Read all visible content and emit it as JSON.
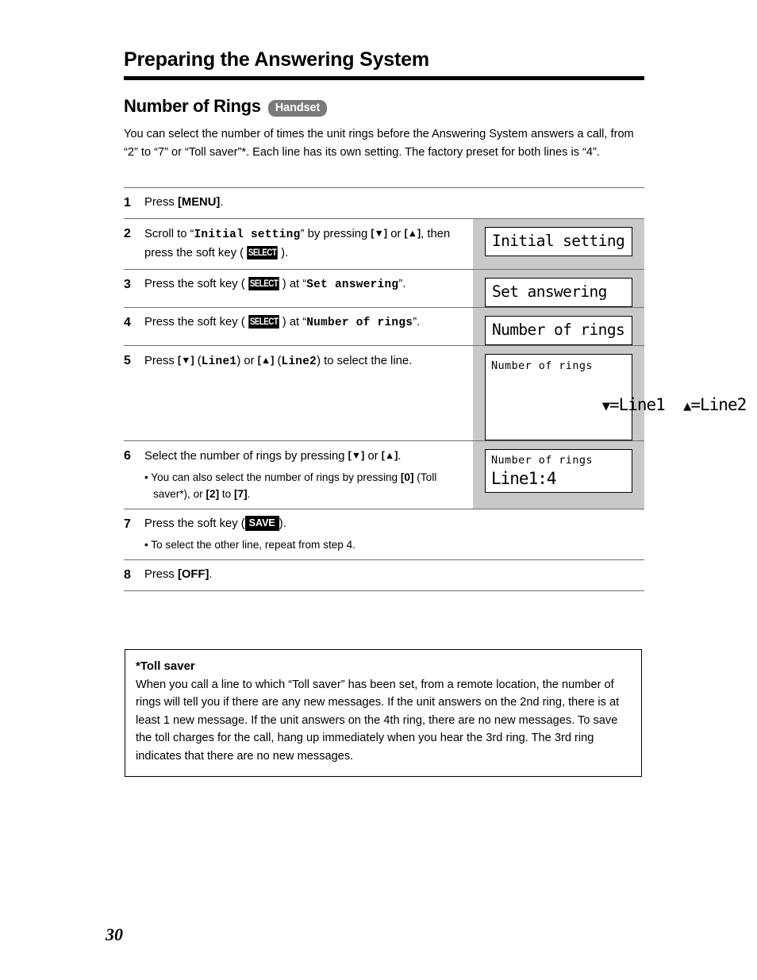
{
  "header": {
    "chapter_title": "Preparing the Answering System"
  },
  "section": {
    "title": "Number of Rings",
    "badge": "Handset",
    "intro": "You can select the number of times the unit rings before the Answering System answers a call, from “2” to “7” or “Toll saver”*. Each line has its own setting. The factory preset for both lines is “4”."
  },
  "steps": [
    {
      "num": "1",
      "text_parts": {
        "a": "Press ",
        "key": "[MENU]",
        "b": "."
      }
    },
    {
      "num": "2",
      "text_parts": {
        "a": "Scroll to “",
        "mono1": "Initial setting",
        "b": "” by pressing ",
        "key1": "[▼]",
        "c": " or ",
        "key2": "[▲]",
        "d": ", then press the soft key (",
        "softkey": "SELECT",
        "e": ")."
      },
      "lcd": {
        "lines": [
          "Initial setting"
        ]
      }
    },
    {
      "num": "3",
      "text_parts": {
        "a": "Press the soft key (",
        "softkey": "SELECT",
        "b": ") at “",
        "mono1": "Set answering",
        "c": "”."
      },
      "lcd": {
        "lines": [
          "Set answering"
        ]
      }
    },
    {
      "num": "4",
      "text_parts": {
        "a": "Press the soft key (",
        "softkey": "SELECT",
        "b": ") at “",
        "mono1": "Number of rings",
        "c": "”."
      },
      "lcd": {
        "lines": [
          "Number of rings"
        ]
      }
    },
    {
      "num": "5",
      "text_parts": {
        "a": "Press ",
        "key1": "[▼]",
        "b": " (",
        "mono1": "Line1",
        "c": ") or ",
        "key2": "[▲]",
        "d": " (",
        "mono2": "Line2",
        "e": ") to select the line."
      },
      "lcd": {
        "title": "Number of rings",
        "row_left": "=Line1",
        "row_right": "=Line2"
      }
    },
    {
      "num": "6",
      "text_parts": {
        "a": "Select the number of rings by pressing ",
        "key1": "[▼]",
        "b": " or ",
        "key2": "[▲]",
        "c": "."
      },
      "bullet_parts": {
        "a": "• You can also select the number of rings by pressing ",
        "key1": "[0]",
        "b": " (Toll saver*), or ",
        "key2": "[2]",
        "c": " to ",
        "key3": "[7]",
        "d": "."
      },
      "lcd": {
        "title": "Number of rings",
        "value": "Line1:4"
      }
    },
    {
      "num": "7",
      "text_parts": {
        "a": "Press the soft key (",
        "softkey": "SAVE",
        "b": ")."
      },
      "bullet_parts": {
        "a": "• To select the other line, repeat from step 4."
      }
    },
    {
      "num": "8",
      "text_parts": {
        "a": "Press ",
        "key": "[OFF]",
        "b": "."
      }
    }
  ],
  "note": {
    "title": "*Toll saver",
    "body": "When you call a line to which “Toll saver” has been set, from a remote location, the number of rings will tell you if there are any new messages. If the unit answers on the 2nd ring, there is at least 1 new message. If the unit answers on the 4th ring, there are no new messages. To save the toll charges for the call, hang up immediately when you hear the 3rd ring. The 3rd ring indicates that there are no new messages."
  },
  "footer": {
    "page_number": "30"
  },
  "colors": {
    "shaded_column": "#c9c9c9",
    "badge_gray": "#7a7a7a",
    "rule_black": "#000000",
    "divider_gray": "#6f6f6f"
  }
}
